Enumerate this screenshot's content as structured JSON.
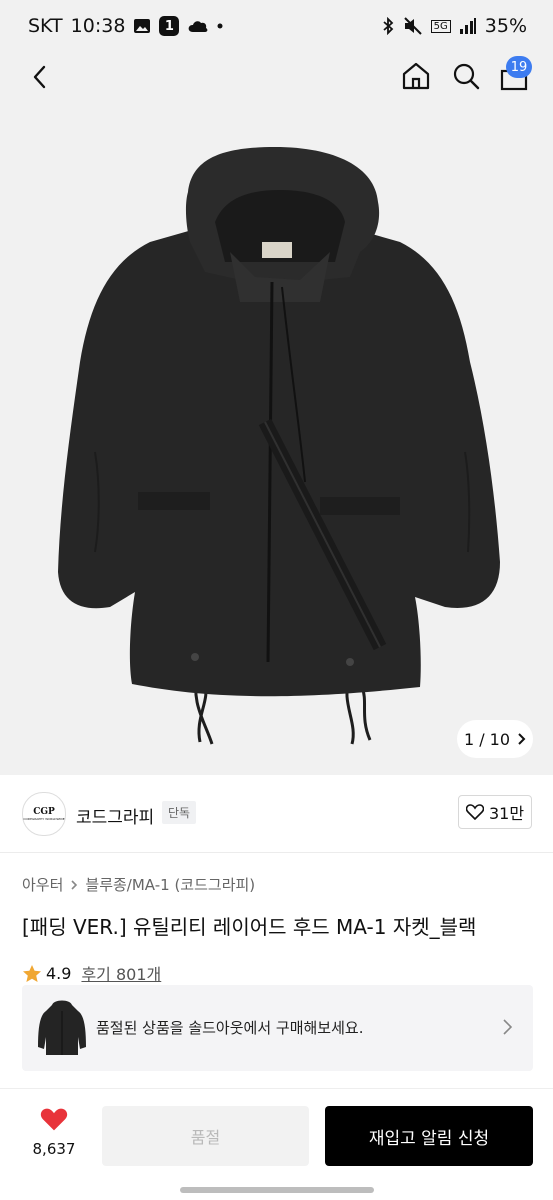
{
  "status_bar": {
    "carrier": "SKT",
    "time": "10:38",
    "notification_count": "1",
    "network": "5G",
    "battery": "35%"
  },
  "header": {
    "cart_badge": "19"
  },
  "gallery": {
    "counter": "1 / 10"
  },
  "brand": {
    "logo_text": "CGP",
    "logo_subtext": "CODEGRAPHY WORLDWIDE",
    "name": "코드그라피",
    "tag": "단독",
    "likes": "31만"
  },
  "breadcrumb": [
    "아우터",
    "블루종/MA-1 (코드그라피)"
  ],
  "product": {
    "title": "[패딩 VER.] 유틸리티 레이어드 후드 MA-1 자켓_블랙",
    "rating": "4.9",
    "reviews": "후기 801개"
  },
  "soldout_banner": {
    "text": "품절된 상품을 솔드아웃에서 구매해보세요."
  },
  "bottom_bar": {
    "like_count": "8,637",
    "soldout_label": "품절",
    "restock_label": "재입고 알림 신청"
  },
  "colors": {
    "accent_badge": "#3d7cf0",
    "heart_red": "#e8333a",
    "star": "#f0a733"
  }
}
